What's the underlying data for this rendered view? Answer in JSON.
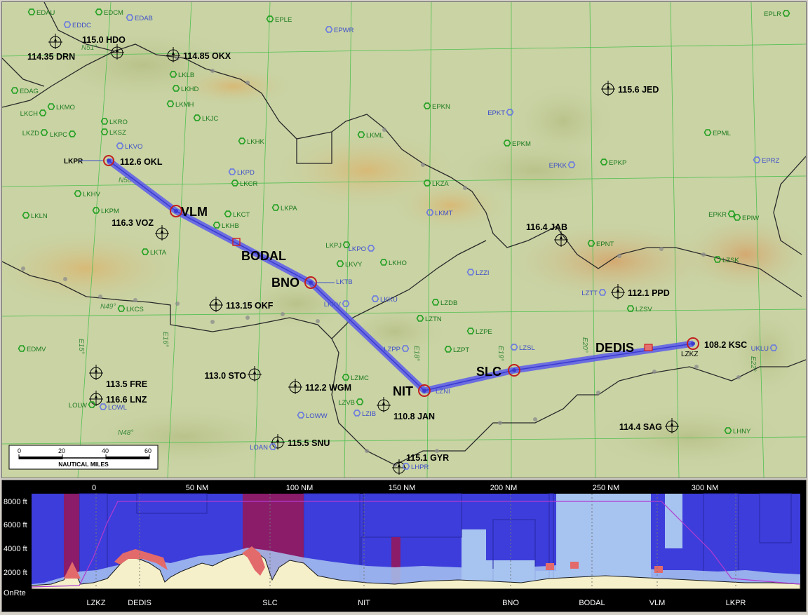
{
  "route": {
    "waypoints": [
      {
        "name": "LKPR"
      },
      {
        "name": "VLM"
      },
      {
        "name": "BODAL"
      },
      {
        "name": "BNO"
      },
      {
        "name": "NIT"
      },
      {
        "name": "SLC"
      },
      {
        "name": "DEDIS"
      },
      {
        "name": "LZKZ"
      }
    ],
    "waypoint_labels": {
      "vlm": "VLM",
      "bodal": "BODAL",
      "bno": "BNO",
      "nit": "NIT",
      "slc": "SLC",
      "dedis": "DEDIS",
      "lkpr": "LKPR",
      "lzkz": "LZKZ",
      "lktb": "LKTB",
      "lzni": "LZNI"
    }
  },
  "navaids": [
    {
      "id": "drn",
      "label": "114.35 DRN"
    },
    {
      "id": "hdo",
      "label": "115.0 HDO"
    },
    {
      "id": "okx",
      "label": "114.85 OKX"
    },
    {
      "id": "jed",
      "label": "115.6 JED"
    },
    {
      "id": "okl",
      "label": "112.6 OKL"
    },
    {
      "id": "voz",
      "label": "116.3 VOZ"
    },
    {
      "id": "jab",
      "label": "116.4 JAB"
    },
    {
      "id": "ppd",
      "label": "112.1 PPD"
    },
    {
      "id": "okf",
      "label": "113.15 OKF"
    },
    {
      "id": "ksc",
      "label": "108.2 KSC"
    },
    {
      "id": "sto",
      "label": "113.0 STO"
    },
    {
      "id": "wgm",
      "label": "112.2 WGM"
    },
    {
      "id": "fre",
      "label": "113.5 FRE"
    },
    {
      "id": "lnz",
      "label": "116.6 LNZ"
    },
    {
      "id": "jan",
      "label": "110.8 JAN"
    },
    {
      "id": "sag",
      "label": "114.4 SAG"
    },
    {
      "id": "snu",
      "label": "115.5 SNU"
    },
    {
      "id": "gyr",
      "label": "115.1 GYR"
    }
  ],
  "airports_green": [
    "EDAU",
    "EDCM",
    "EPLE",
    "EPLR",
    "LKLB",
    "LKHD",
    "LKMO",
    "LKMH",
    "LKCH",
    "LKJC",
    "LKRO",
    "LKZD",
    "LKPC",
    "LKSZ",
    "LKHK",
    "LKML",
    "EPKN",
    "EPML",
    "EPKM",
    "EPKP",
    "LKCR",
    "LKZA",
    "LKPA",
    "LKHV",
    "LKPM",
    "LKLN",
    "LKCT",
    "LKHB",
    "LKTA",
    "LKPJ",
    "LKVY",
    "LKHO",
    "LZSK",
    "EPNT",
    "LZSV",
    "LKCS",
    "LZDB",
    "LZTN",
    "LZPE",
    "EDMV",
    "LZPT",
    "LZMC",
    "LOLW",
    "LZVB",
    "EPKR",
    "EPIW",
    "LHNY",
    "EDAG"
  ],
  "airports_blue": [
    "EDDC",
    "EDAB",
    "EPWR",
    "EPKT",
    "EPKK",
    "EPRZ",
    "LKVO",
    "LKPD",
    "LKMT",
    "LKPO",
    "LZZI",
    "LZTT",
    "LKKU",
    "LKKV",
    "LZPP",
    "LZSL",
    "UKLU",
    "LOWW",
    "LZIB",
    "LOWL",
    "LOAN",
    "LHPR"
  ],
  "grid_labels": [
    "N51°",
    "N50°",
    "N49°",
    "N48°",
    "E16°",
    "E15°",
    "E18°",
    "E19°",
    "E20°",
    "E22°"
  ],
  "scale_bar": {
    "ticks": [
      "0",
      "20",
      "40",
      "60"
    ],
    "unit": "NAUTICAL MILES"
  },
  "profile": {
    "distance_ticks": [
      "0",
      "50 NM",
      "100 NM",
      "150 NM",
      "200 NM",
      "250 NM",
      "300 NM"
    ],
    "altitude_ticks": [
      "8000 ft",
      "6000 ft",
      "4000 ft",
      "2000 ft",
      "OnRte"
    ],
    "waypoints": [
      "LZKZ",
      "DEDIS",
      "SLC",
      "NIT",
      "BNO",
      "BODAL",
      "VLM",
      "LKPR"
    ],
    "colors": {
      "airspace_dark": "#3d3ddb",
      "airspace_light": "#a7c3f0",
      "restricted": "#8a1c6a",
      "terrain": "#f5f0c9",
      "terrain_danger": "#e36a6a",
      "route_line": "#b13bd1"
    }
  },
  "colors": {
    "route": "#5a5aeb",
    "map_bg": "#c9d3a4",
    "grid": "#52c052",
    "airport_green": "#22a022",
    "airport_blue": "#6a7ae0"
  }
}
